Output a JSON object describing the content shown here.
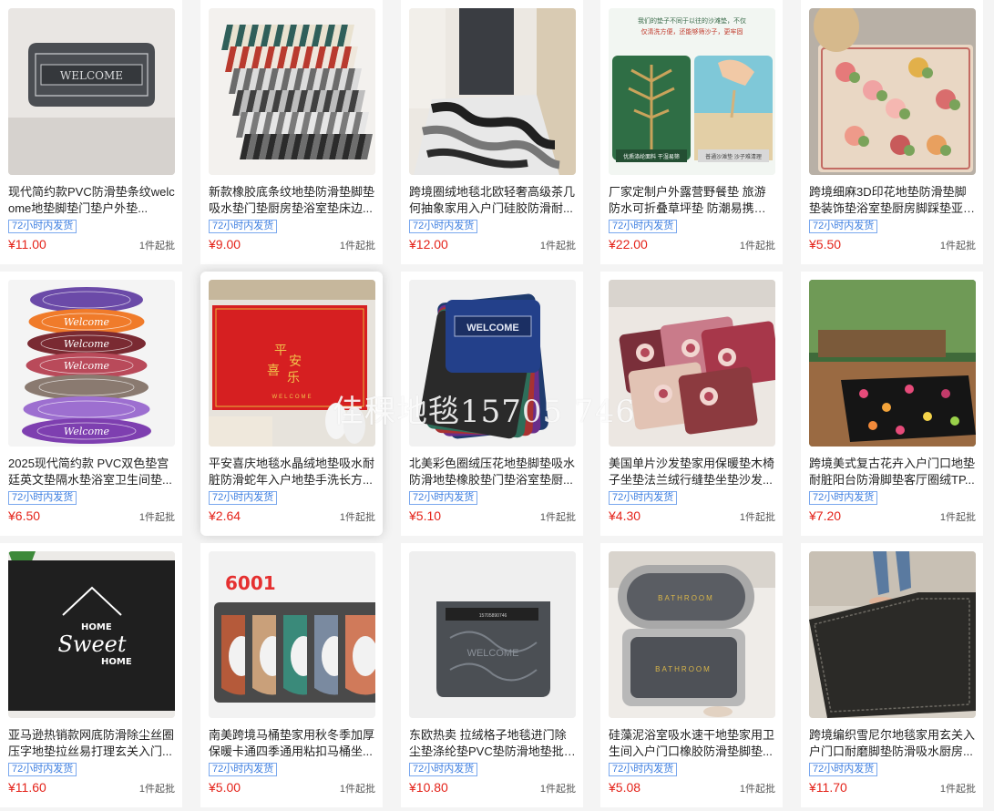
{
  "products": [
    {
      "title": "现代简约款PVC防滑垫条纹welcome地垫脚垫门垫户外垫...",
      "tag": "72小时内发货",
      "price": "¥11.00",
      "moq": "1件起批",
      "image": "welcome-mat-gray"
    },
    {
      "title": "新款橡胶底条纹地垫防滑垫脚垫吸水垫门垫厨房垫浴室垫床边...",
      "tag": "72小时内发货",
      "price": "¥9.00",
      "moq": "1件起批",
      "image": "striped-mats-stack"
    },
    {
      "title": "跨境圈绒地毯北欧轻奢高级茶几何抽象家用入户门硅胶防滑耐...",
      "tag": "72小时内发货",
      "price": "¥12.00",
      "moq": "1件起批",
      "image": "wave-hallway-rug"
    },
    {
      "title": "厂家定制户外露营野餐垫 旅游防水可折叠草坪垫 防潮易携带沙...",
      "tag": "72小时内发货",
      "price": "¥22.00",
      "moq": "1件起批",
      "image": "sand-free-beach-mat"
    },
    {
      "title": "跨境细麻3D印花地垫防滑垫脚垫装饰垫浴室垫厨房脚踩垫亚麻...",
      "tag": "72小时内发货",
      "price": "¥5.50",
      "moq": "1件起批",
      "image": "floral-print-mat"
    },
    {
      "title": "2025现代简约款 PVC双色垫宫廷英文垫隔水垫浴室卫生间垫...",
      "tag": "72小时内发货",
      "price": "¥6.50",
      "moq": "1件起批",
      "image": "oval-welcome-mats"
    },
    {
      "title": "平安喜庆地毯水晶绒地垫吸水耐脏防滑蛇年入户地垫手洗长方...",
      "tag": "72小时内发货",
      "price": "¥2.64",
      "moq": "1件起批",
      "image": "red-pingan-mat"
    },
    {
      "title": "北美彩色圈绒压花地垫脚垫吸水防滑地垫橡胶垫门垫浴室垫厨...",
      "tag": "72小时内发货",
      "price": "¥5.10",
      "moq": "1件起批",
      "image": "loop-pile-welcome-mats"
    },
    {
      "title": "美国单片沙发垫家用保暖垫木椅子坐垫法兰绒行缝垫坐垫沙发...",
      "tag": "72小时内发货",
      "price": "¥4.30",
      "moq": "1件起批",
      "image": "flannel-sofa-pads"
    },
    {
      "title": "跨境美式复古花卉入户门口地垫耐脏阳台防滑脚垫客厅圈绒TP...",
      "tag": "72小时内发货",
      "price": "¥7.20",
      "moq": "1件起批",
      "image": "vintage-floral-rug"
    },
    {
      "title": "亚马逊热销款网底防滑除尘丝圈压字地垫拉丝易打理玄关入门...",
      "tag": "72小时内发货",
      "price": "¥11.60",
      "moq": "1件起批",
      "image": "home-sweet-home-mat"
    },
    {
      "title": "南美跨境马桶垫家用秋冬季加厚保暖卡通四季通用粘扣马桶坐...",
      "tag": "72小时内发货",
      "price": "¥5.00",
      "moq": "1件起批",
      "image": "toilet-seat-covers"
    },
    {
      "title": "东欧热卖 拉绒格子地毯进门除尘垫涤纶垫PVC垫防滑地垫批发...",
      "tag": "72小时内发货",
      "price": "¥10.80",
      "moq": "1件起批",
      "image": "gray-embossed-mat"
    },
    {
      "title": "硅藻泥浴室吸水速干地垫家用卫生间入户门口橡胶防滑垫脚垫...",
      "tag": "72小时内发货",
      "price": "¥5.08",
      "moq": "1件起批",
      "image": "bathroom-mats"
    },
    {
      "title": "跨境编织雪尼尔地毯家用玄关入户门口耐磨脚垫防滑吸水厨房...",
      "tag": "72小时内发货",
      "price": "¥11.70",
      "moq": "1件起批",
      "image": "chenille-runner"
    }
  ],
  "image_text": {
    "welcome": "WELCOME",
    "beach_banner": "我们的垫子不同于以往的沙滩垫，不仅仅清洗方便，还能够筛沙子，更牢固",
    "beach_left_caption": "优质涤纶面料 干湿易筛",
    "beach_right_caption": "普通沙滩垫 沙子难清理",
    "pingan_chars": [
      "平",
      "安",
      "喜",
      "乐"
    ],
    "pingan_sub": "WELCOME",
    "oval_word": "Welcome",
    "home_sweet_home": [
      "HOME",
      "Sweet",
      "HOME"
    ],
    "product_code": "6001",
    "bathroom": "BATHROOM"
  },
  "watermark": "佳稞地毯15705 746",
  "colors": {
    "price": "#e4231a",
    "tag": "#3b7de0",
    "page_bg": "#f4f4f4"
  }
}
